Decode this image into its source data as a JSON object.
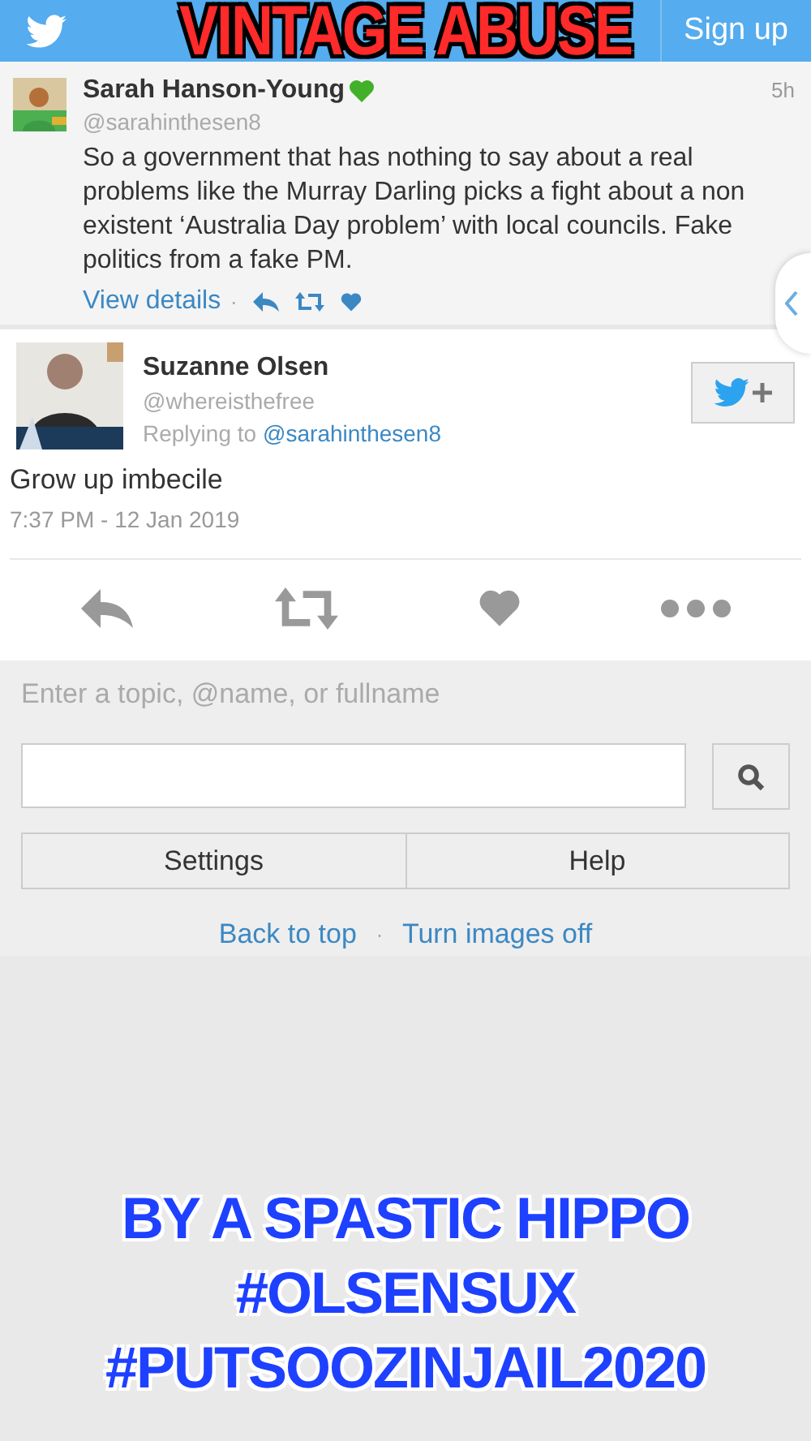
{
  "header": {
    "button": "Sign up"
  },
  "captions": {
    "top": "VINTAGE ABUSE",
    "bottom": "BY A SPASTIC HIPPO #OLSENSUX #PUTSOOZINJAIL2020"
  },
  "tweet": {
    "name": "Sarah Hanson-Young",
    "handle": "@sarahinthesen8",
    "time": "5h",
    "text": "So a government that has nothing to say about a real problems like the Murray Darling picks a fight about a non existent ‘Australia Day problem’ with local councils. Fake politics from a fake PM.",
    "details_link": "View details",
    "separator": "·"
  },
  "reply": {
    "name": "Suzanne Olsen",
    "handle": "@whereisthefree",
    "replying_label": "Replying to",
    "replying_handle": "@sarahinthesen8",
    "text": "Grow up imbecile",
    "timestamp": "7:37 PM - 12 Jan 2019"
  },
  "search": {
    "label": "Enter a topic, @name, or fullname"
  },
  "buttons": [
    "Settings",
    "Help"
  ],
  "footer_links": [
    "Back to top",
    "Turn images off"
  ],
  "footer_separator": "·"
}
